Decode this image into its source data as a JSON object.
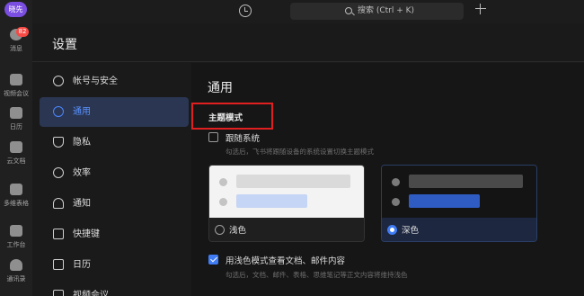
{
  "user": {
    "avatar_text": "晓先"
  },
  "rail": {
    "items": [
      {
        "label": "消息",
        "icon": "chat-icon",
        "badge": "82"
      },
      {
        "label": "视频会议",
        "icon": "video-icon"
      },
      {
        "label": "日历",
        "icon": "calendar-icon"
      },
      {
        "label": "云文档",
        "icon": "cloud-doc-icon"
      },
      {
        "label": "多维表格",
        "icon": "table-icon"
      },
      {
        "label": "工作台",
        "icon": "workspace-icon"
      },
      {
        "label": "通讯录",
        "icon": "contacts-icon"
      }
    ]
  },
  "topbar": {
    "search_placeholder": "搜索 (Ctrl + K)"
  },
  "settings": {
    "title": "设置",
    "nav": [
      {
        "label": "帐号与安全",
        "icon": "user-icon",
        "active": false
      },
      {
        "label": "通用",
        "icon": "gear-icon",
        "active": true
      },
      {
        "label": "隐私",
        "icon": "shield-icon",
        "active": false
      },
      {
        "label": "效率",
        "icon": "bulb-icon",
        "active": false
      },
      {
        "label": "通知",
        "icon": "bell-icon",
        "active": false
      },
      {
        "label": "快捷键",
        "icon": "keyboard-icon",
        "active": false
      },
      {
        "label": "日历",
        "icon": "calendar-icon",
        "active": false
      },
      {
        "label": "视频会议",
        "icon": "video-icon",
        "active": false
      }
    ],
    "section_title": "通用",
    "theme_mode": {
      "label": "主题模式",
      "follow_system": {
        "label": "跟随系统",
        "checked": false,
        "hint": "勾选后，飞书将跟随设备的系统设置切换主题模式"
      },
      "light": {
        "label": "浅色",
        "selected": false
      },
      "dark": {
        "label": "深色",
        "selected": true
      },
      "light_docs": {
        "label": "用浅色模式查看文档、邮件内容",
        "checked": true,
        "hint": "勾选后，文档、邮件、表格、思维笔记等正文内容将维持浅色"
      }
    }
  },
  "colors": {
    "accent": "#3f7cf5",
    "highlight_box": "#e02020",
    "badge": "#f54a45"
  }
}
